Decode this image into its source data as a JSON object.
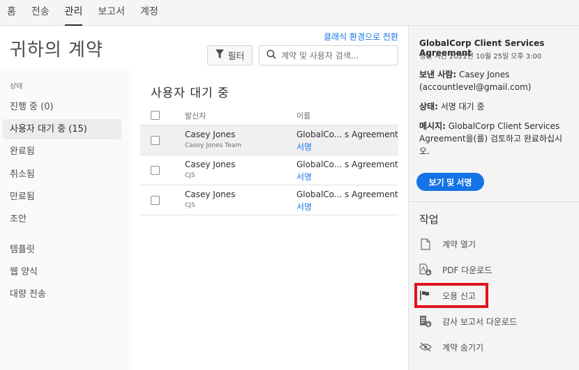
{
  "topnav": {
    "tabs": [
      {
        "label": "홈",
        "active": false
      },
      {
        "label": "전송",
        "active": false
      },
      {
        "label": "관리",
        "active": true
      },
      {
        "label": "보고서",
        "active": false
      },
      {
        "label": "계정",
        "active": false
      }
    ]
  },
  "header": {
    "page_title": "귀하의 계약",
    "classic_link": "클래식 환경으로 전환",
    "filter_label": "필터",
    "search_placeholder": "계약 및 사용자 검색..."
  },
  "sidebar": {
    "section_label": "상태",
    "items": [
      {
        "label": "진행 중 (0)",
        "active": false
      },
      {
        "label": "사용자 대기 중 (15)",
        "active": true
      },
      {
        "label": "완료됨",
        "active": false
      },
      {
        "label": "취소됨",
        "active": false
      },
      {
        "label": "만료됨",
        "active": false
      },
      {
        "label": "초안",
        "active": false
      },
      {
        "label": "템플릿",
        "active": false
      },
      {
        "label": "웹 양식",
        "active": false
      },
      {
        "label": "대량 전송",
        "active": false
      }
    ]
  },
  "list": {
    "title": "사용자 대기 중",
    "columns": {
      "sender": "발신자",
      "name": "이름"
    },
    "rows": [
      {
        "sender": "Casey Jones",
        "sender_sub": "Casey Jones Team",
        "name": "GlobalCo... s Agreement",
        "status": "서명",
        "selected": true
      },
      {
        "sender": "Casey Jones",
        "sender_sub": "CJS",
        "name": "GlobalCo... s Agreement",
        "status": "서명",
        "selected": false
      },
      {
        "sender": "Casey Jones",
        "sender_sub": "CJS",
        "name": "GlobalCo... s Agreement",
        "status": "서명",
        "selected": false
      }
    ]
  },
  "detail": {
    "title": "GlobalCorp Client Services Agreement",
    "created": "생성 시간 2021년 10월 25일 오후 3:00",
    "sender_label": "보낸 사람:",
    "sender_value": "Casey Jones (accountlevel@gmail.com)",
    "status_label": "상태:",
    "status_value": "서명 대기 중",
    "message_label": "메시지:",
    "message_value": "GlobalCorp Client Services Agreement을(를) 검토하고 완료하십시오.",
    "primary_button": "보기 및 서명",
    "actions_title": "작업",
    "actions": [
      {
        "label": "계약 열기",
        "icon": "document-icon"
      },
      {
        "label": "PDF 다운로드",
        "icon": "pdf-download-icon"
      },
      {
        "label": "오용 신고",
        "icon": "flag-icon",
        "highlighted": true
      },
      {
        "label": "감사 보고서 다운로드",
        "icon": "audit-report-download-icon"
      },
      {
        "label": "계약 숨기기",
        "icon": "hide-eye-icon"
      }
    ]
  },
  "colors": {
    "accent": "#1473e6",
    "highlight_box": "#e0141e"
  }
}
